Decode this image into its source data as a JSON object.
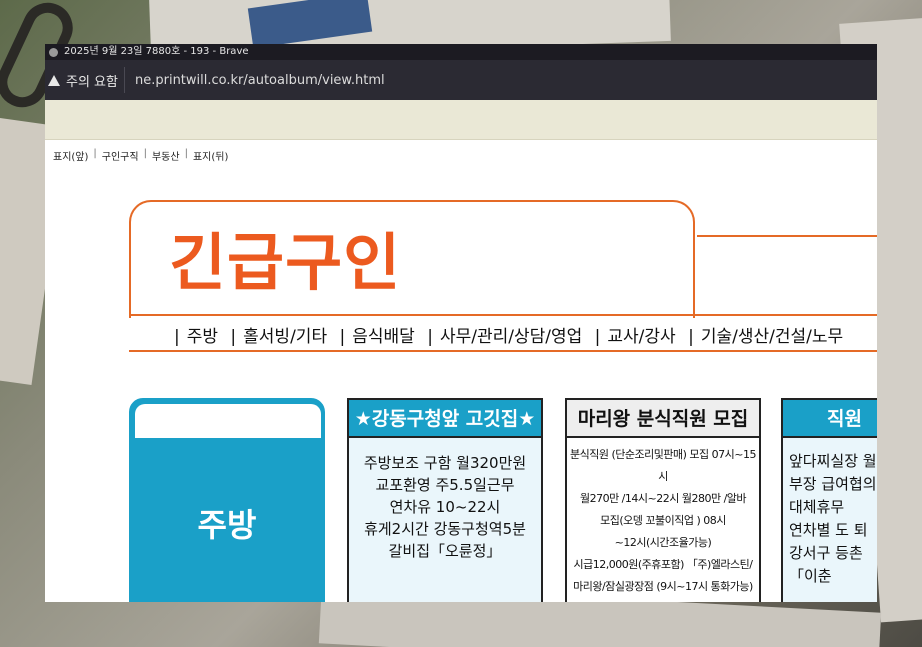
{
  "window": {
    "title": "2025년 9월 23일 7880호 - 193 - Brave"
  },
  "urlbar": {
    "security_label": "주의 요함",
    "url": "ne.printwill.co.kr/autoalbum/view.html"
  },
  "nav": {
    "links": [
      "표지(앞)",
      "구인구직",
      "부동산",
      "표지(뒤)"
    ],
    "separator": "|"
  },
  "banner": {
    "title": "긴급구인",
    "categories": [
      "주방",
      "홀서빙/기타",
      "음식배달",
      "사무/관리/상담/영업",
      "교사/강사",
      "기술/생산/건설/노무"
    ],
    "separator": "|"
  },
  "category_card": {
    "label": "주방"
  },
  "ads": [
    {
      "title": "★강동구청앞 고깃집★",
      "lines": [
        "주방보조 구함   월320만원",
        "교포환영  주5.5일근무",
        "연차유 10~22시",
        "휴게2시간 강동구청역5분",
        "갈비집「오륜정」"
      ]
    },
    {
      "title": "마리왕 분식직원 모집",
      "lines": [
        "분식직원 (단순조리및판매) 모집 07시~15시",
        "월270만  /14시~22시 월280만 /알바",
        "모집(오뎅 꼬불이직업 ) 08시",
        "~12시(시간조율가능)",
        "시급12,000원(주휴포함) 「주)엘라스틴/",
        "마리왕/잠실광장점 (9시~17시 통화가능)"
      ]
    },
    {
      "title": "직원",
      "lines": [
        "앞다찌실장 월",
        "부장 급여협의",
        "대체휴무",
        "연차별 도 퇴",
        "강서구 등촌",
        "「이춘"
      ]
    }
  ],
  "colors": {
    "accent_orange": "#ec5a1f",
    "accent_blue": "#1aa0c8",
    "browser_dark": "#2b2a33"
  }
}
